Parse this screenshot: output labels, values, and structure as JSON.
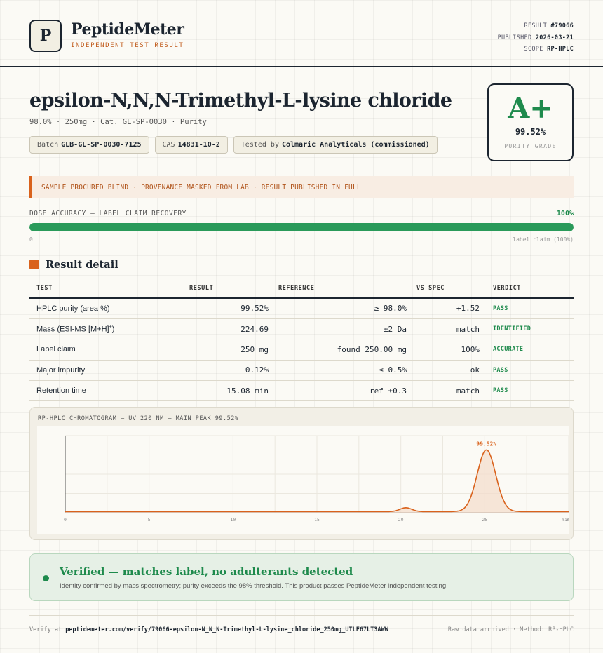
{
  "header": {
    "logo_letter": "P",
    "brand": "PeptideMeter",
    "tagline": "INDEPENDENT TEST RESULT",
    "meta": [
      {
        "label": "RESULT",
        "value": "#79066"
      },
      {
        "label": "PUBLISHED",
        "value": "2026-03-21"
      },
      {
        "label": "SCOPE",
        "value": "RP-HPLC"
      }
    ]
  },
  "product": {
    "name": "epsilon-N,N,N-Trimethyl-L-lysine chloride",
    "subtitle": "98.0% · 250mg · Cat. GL-SP-0030 · Purity",
    "chips": [
      {
        "label": "Batch",
        "value": "GLB-GL-SP-0030-7125"
      },
      {
        "label": "CAS",
        "value": "14831-10-2"
      },
      {
        "label": "Tested by",
        "value": "Colmaric Analyticals (commissioned)"
      }
    ]
  },
  "grade": {
    "letter": "A+",
    "value": "99.52%",
    "label": "PURITY GRADE"
  },
  "notice": "SAMPLE PROCURED BLIND · PROVENANCE MASKED FROM LAB · RESULT PUBLISHED IN FULL",
  "dose": {
    "label": "DOSE ACCURACY — LABEL CLAIM RECOVERY",
    "percent_text": "100%",
    "fill_percent": 100,
    "min_label": "0",
    "max_label": "label claim (100%)"
  },
  "section_title": "Result detail",
  "table": {
    "headers": [
      "TEST",
      "RESULT",
      "REFERENCE",
      "VS SPEC",
      "VERDICT"
    ],
    "rows": [
      {
        "test": "HPLC purity (area %)",
        "sup": "",
        "result": "99.52%",
        "reference": "≥ 98.0%",
        "spec": "+1.52",
        "verdict": "PASS"
      },
      {
        "test": "Mass (ESI-MS [M+H]",
        "sup": "+",
        "tail": ")",
        "result": "224.69",
        "reference": "±2 Da",
        "spec": "match",
        "verdict": "IDENTIFIED"
      },
      {
        "test": "Label claim",
        "sup": "",
        "result": "250 mg",
        "reference": "found 250.00 mg",
        "spec": "100%",
        "verdict": "ACCURATE"
      },
      {
        "test": "Major impurity",
        "sup": "",
        "result": "0.12%",
        "reference": "≤ 0.5%",
        "spec": "ok",
        "verdict": "PASS"
      },
      {
        "test": "Retention time",
        "sup": "",
        "result": "15.08 min",
        "reference": "ref ±0.3",
        "spec": "match",
        "verdict": "PASS"
      }
    ]
  },
  "chart_data": {
    "type": "line",
    "title": "RP-HPLC CHROMATOGRAM — UV 220 NM — MAIN PEAK 99.52%",
    "x_ticks": [
      0,
      5,
      10,
      15,
      20,
      25,
      30
    ],
    "x_tick_labels": [
      "0",
      "5",
      "10",
      "15",
      "20",
      "25",
      "30"
    ],
    "end_label": "min",
    "xlim": [
      0,
      30
    ],
    "ylim": [
      0,
      100
    ],
    "baseline": 1.5,
    "peaks": [
      {
        "x": 20.3,
        "height": 5,
        "width": 0.35
      },
      {
        "x": 25.1,
        "height": 80,
        "width": 0.55
      }
    ],
    "annotation": {
      "x": 25.1,
      "text": "99.52%"
    },
    "line_color": "#d9621c",
    "fill_color": "#f3dccb"
  },
  "verified": {
    "title": "Verified — matches label, no adulterants detected",
    "subtitle": "Identity confirmed by mass spectrometry; purity exceeds the 98% threshold. This product passes PeptideMeter independent testing."
  },
  "footer": {
    "verify_prefix": "Verify at",
    "verify_url": "peptidemeter.com/verify/79066-epsilon-N_N_N-Trimethyl-L-lysine_chloride_250mg_UTLF67LT3AWW",
    "right": "Raw data archived · Method: RP-HPLC"
  }
}
